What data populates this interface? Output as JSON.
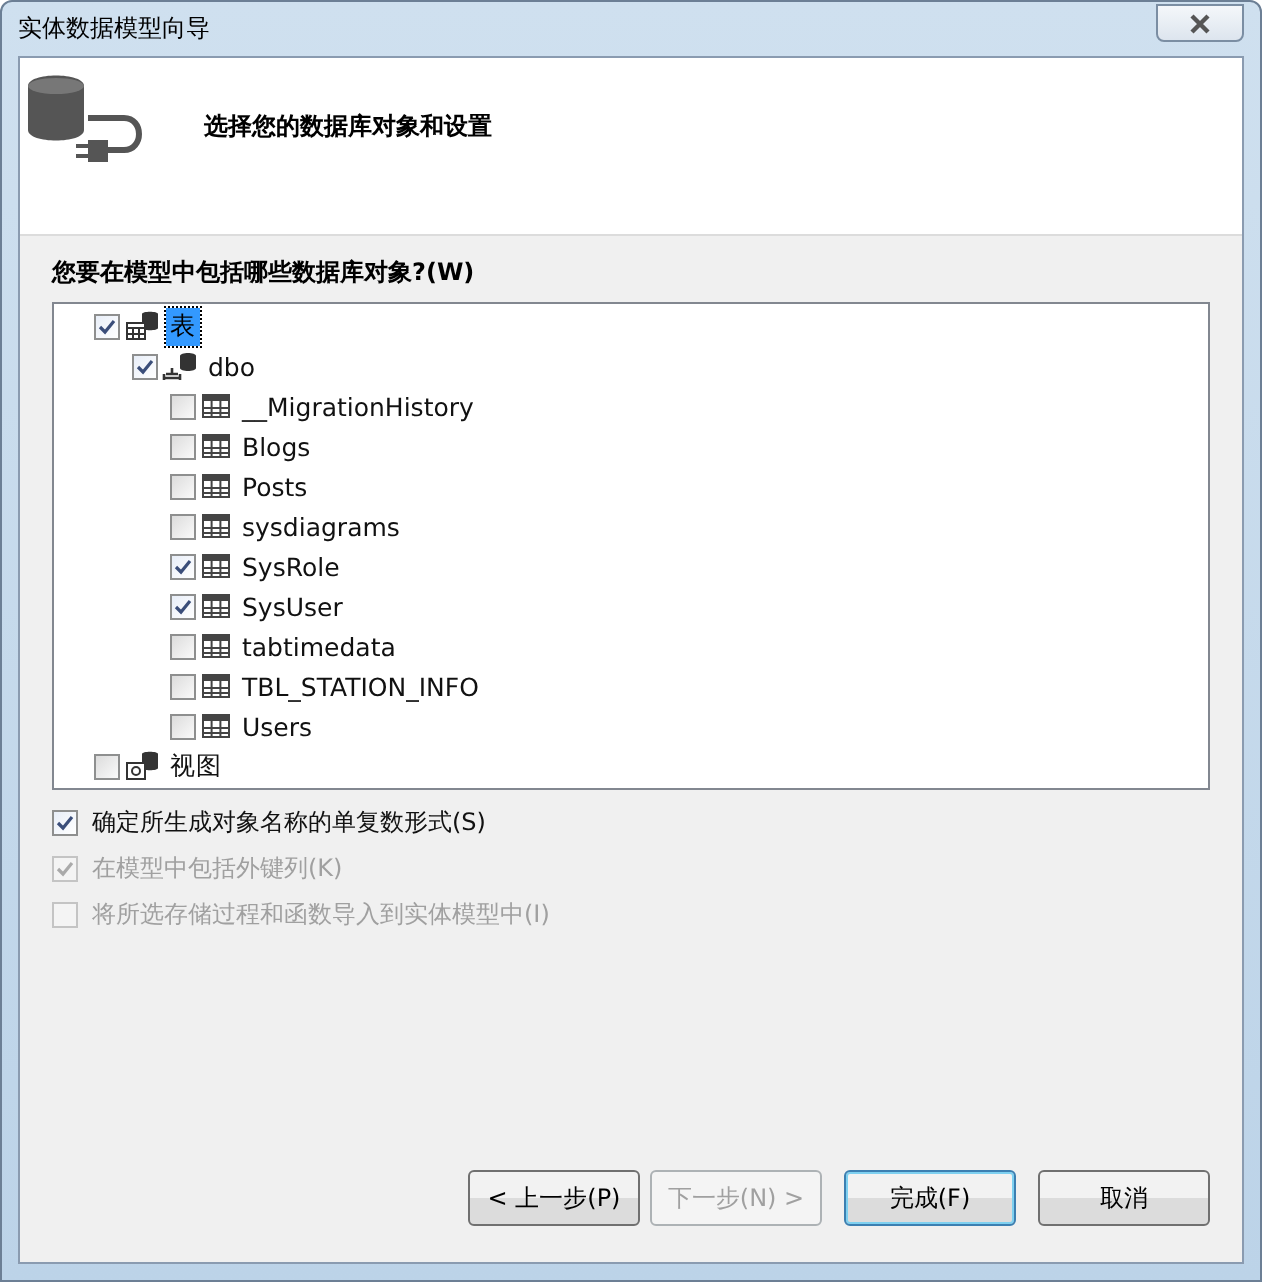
{
  "window": {
    "title": "实体数据模型向导"
  },
  "header": {
    "title": "选择您的数据库对象和设置"
  },
  "tree_label": "您要在模型中包括哪些数据库对象?(W)",
  "tree": [
    {
      "label": "表",
      "kind": "tables",
      "checked": true,
      "selected": true,
      "children": [
        {
          "label": "dbo",
          "kind": "schema",
          "checked": true,
          "selected": false,
          "children": [
            {
              "label": "__MigrationHistory",
              "kind": "table",
              "checked": false,
              "selected": false
            },
            {
              "label": "Blogs",
              "kind": "table",
              "checked": false,
              "selected": false
            },
            {
              "label": "Posts",
              "kind": "table",
              "checked": false,
              "selected": false
            },
            {
              "label": "sysdiagrams",
              "kind": "table",
              "checked": false,
              "selected": false
            },
            {
              "label": "SysRole",
              "kind": "table",
              "checked": true,
              "selected": false
            },
            {
              "label": "SysUser",
              "kind": "table",
              "checked": true,
              "selected": false
            },
            {
              "label": "tabtimedata",
              "kind": "table",
              "checked": false,
              "selected": false
            },
            {
              "label": "TBL_STATION_INFO",
              "kind": "table",
              "checked": false,
              "selected": false
            },
            {
              "label": "Users",
              "kind": "table",
              "checked": false,
              "selected": false
            }
          ]
        }
      ]
    },
    {
      "label": "视图",
      "kind": "views",
      "checked": false,
      "selected": false
    }
  ],
  "options": [
    {
      "label": "确定所生成对象名称的单复数形式(S)",
      "checked": true,
      "disabled": false
    },
    {
      "label": "在模型中包括外键列(K)",
      "checked": true,
      "disabled": true
    },
    {
      "label": "将所选存储过程和函数导入到实体模型中(I)",
      "checked": false,
      "disabled": true
    }
  ],
  "buttons": [
    {
      "label": "< 上一步(P)",
      "disabled": false,
      "default": false
    },
    {
      "label": "下一步(N) >",
      "disabled": true,
      "default": false
    },
    {
      "label": "完成(F)",
      "disabled": false,
      "default": true
    },
    {
      "label": "取消",
      "disabled": false,
      "default": false
    }
  ]
}
